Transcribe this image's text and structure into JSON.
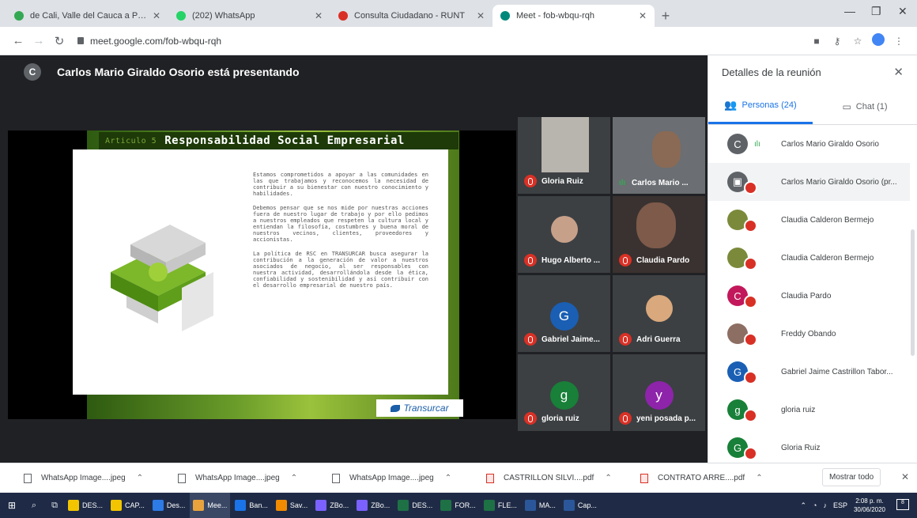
{
  "browser": {
    "tabs": [
      {
        "label": "de Cali, Valle del Cauca a Puerto",
        "color": "#34a853"
      },
      {
        "label": "(202) WhatsApp",
        "color": "#25d366"
      },
      {
        "label": "Consulta Ciudadano - RUNT",
        "color": "#d93025"
      },
      {
        "label": "Meet - fob-wbqu-rqh",
        "color": "#00897b"
      }
    ],
    "new_tab": "+",
    "url": "meet.google.com/fob-wbqu-rqh"
  },
  "meet": {
    "presenter_initial": "C",
    "presenter_text": "Carlos Mario Giraldo Osorio está presentando",
    "slide": {
      "faded_word": "Articulo 5",
      "title": "Responsabilidad Social Empresarial",
      "paragraphs": [
        "Estamos comprometidos a apoyar a las comunidades en las que trabajamos y reconocemos la necesidad de contribuir a su bienestar con nuestro conocimiento y habilidades.",
        "Debemos pensar que se nos mide por nuestras acciones fuera de nuestro lugar de trabajo y por ello pedimos a nuestros empleados que respeten la cultura local y entiendan la filosofía, costumbres y buena moral de nuestros vecinos, clientes, proveedores y accionistas.",
        "La política de RSC en TRANSURCAR busca asegurar la contribución a la generación de valor a nuestros asociados de negocio, al ser responsables con nuestra actividad, desarrollándola desde la ética, confiabilidad y sostenibilidad y así contribuir con el desarrollo empresarial de nuestro país."
      ],
      "logo": "Transurcar"
    },
    "tiles": [
      {
        "name": "Gloria Ruiz",
        "muted": true,
        "photo": true
      },
      {
        "name": "Carlos Mario ...",
        "muted": false,
        "photo": true
      },
      {
        "name": "Hugo Alberto ...",
        "muted": true,
        "photo": true
      },
      {
        "name": "Claudia Pardo",
        "muted": true,
        "photo": true
      },
      {
        "name": "Gabriel Jaime...",
        "muted": true,
        "initial": "G",
        "color": "#1a5fb4"
      },
      {
        "name": "Adri Guerra",
        "muted": true,
        "photo": true
      },
      {
        "name": "gloria ruiz",
        "muted": true,
        "initial": "g",
        "color": "#188038"
      },
      {
        "name": "yeni posada p...",
        "muted": true,
        "initial": "y",
        "color": "#8e24aa"
      }
    ]
  },
  "panel": {
    "title": "Detalles de la reunión",
    "close": "✕",
    "tab_people": "Personas (24)",
    "tab_chat": "Chat (1)",
    "people": [
      {
        "name": "Carlos Mario Giraldo Osorio",
        "initial": "C",
        "color": "#5f6368",
        "muted": false
      },
      {
        "name": "Carlos Mario Giraldo Osorio (pr...",
        "initial": "",
        "color": "#5f6368",
        "muted": true
      },
      {
        "name": "Claudia Calderon Bermejo",
        "initial": "",
        "color": "#7a8a3a",
        "muted": true
      },
      {
        "name": "Claudia Calderon Bermejo",
        "initial": "",
        "color": "#7a8a3a",
        "muted": true
      },
      {
        "name": "Claudia Pardo",
        "initial": "C",
        "color": "#c2185b",
        "muted": true
      },
      {
        "name": "Freddy Obando",
        "initial": "",
        "color": "#8d6e63",
        "muted": true
      },
      {
        "name": "Gabriel Jaime Castrillon Tabor...",
        "initial": "G",
        "color": "#1a5fb4",
        "muted": true
      },
      {
        "name": "gloria ruiz",
        "initial": "g",
        "color": "#188038",
        "muted": true
      },
      {
        "name": "Gloria Ruiz",
        "initial": "G",
        "color": "#188038",
        "muted": true
      }
    ]
  },
  "downloads": {
    "items": [
      {
        "name": "WhatsApp Image....jpeg",
        "type": "img"
      },
      {
        "name": "WhatsApp Image....jpeg",
        "type": "img"
      },
      {
        "name": "WhatsApp Image....jpeg",
        "type": "img"
      },
      {
        "name": "CASTRILLON SILVI....pdf",
        "type": "pdf"
      },
      {
        "name": "CONTRATO ARRE....pdf",
        "type": "pdf"
      }
    ],
    "show_all": "Mostrar todo"
  },
  "taskbar": {
    "apps": [
      {
        "label": "DES...",
        "color": "#f2c500"
      },
      {
        "label": "CAP...",
        "color": "#f2c500"
      },
      {
        "label": "Des...",
        "color": "#2d7be5"
      },
      {
        "label": "Mee...",
        "color": "#e8a33d"
      },
      {
        "label": "Ban...",
        "color": "#1a73e8"
      },
      {
        "label": "Sav...",
        "color": "#f28b00"
      },
      {
        "label": "ZBo...",
        "color": "#7b61ff"
      },
      {
        "label": "ZBo...",
        "color": "#7b61ff"
      },
      {
        "label": "DES...",
        "color": "#1e7145"
      },
      {
        "label": "FOR...",
        "color": "#1e7145"
      },
      {
        "label": "FLE...",
        "color": "#1e7145"
      },
      {
        "label": "MA...",
        "color": "#2b579a"
      },
      {
        "label": "Cap...",
        "color": "#2b579a"
      }
    ],
    "lang": "ESP",
    "time": "2:08 p. m.",
    "date": "30/06/2020",
    "notif_count": "8"
  }
}
